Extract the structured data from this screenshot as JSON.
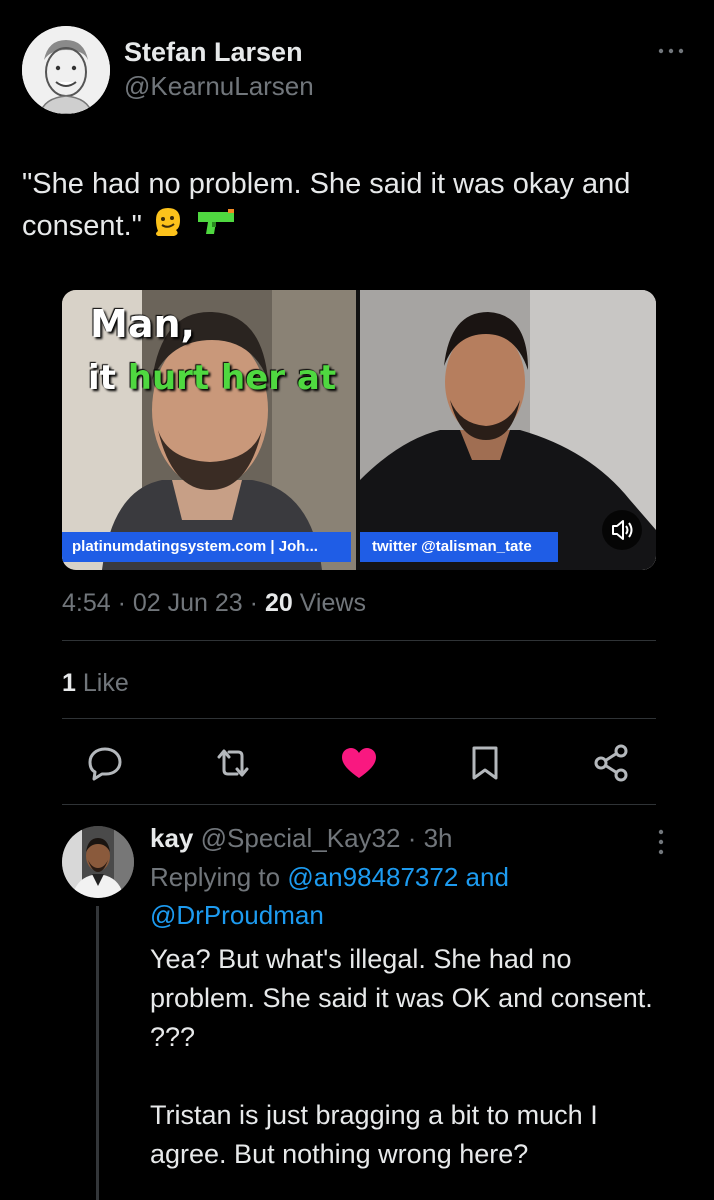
{
  "tweet": {
    "author_name": "Stefan Larsen",
    "author_handle": "@KearnuLarsen",
    "text": "\"She had no problem. She said it was okay and consent.\"",
    "emojis": [
      "melting-face-emoji",
      "water-pistol-emoji"
    ],
    "time": "4:54",
    "date": "02 Jun 23",
    "views_count": "20",
    "views_label": "Views",
    "likes_count": "1",
    "likes_label": "Like",
    "liked": true
  },
  "media": {
    "overlay_line1": "Man,",
    "overlay_line2_start": "it ",
    "overlay_line2_green": "hurt her at",
    "caption_left": "platinumdatingsystem.com | Joh...",
    "caption_right": "twitter @talisman_tate",
    "icons": [
      "speaker-icon"
    ]
  },
  "actions": {
    "icons": [
      "reply-icon",
      "retweet-icon",
      "like-icon",
      "bookmark-icon",
      "share-icon"
    ],
    "like_color": "#f91880"
  },
  "reply": {
    "name": "kay",
    "handle": "@Special_Kay32",
    "time": "3h",
    "replying_prefix": "Replying to",
    "mention1": "@an98487372",
    "connector": "and",
    "mention2": "@DrProudman",
    "text_para1": "Yea? But what's illegal. She had no problem. She said it was OK and consent. ???",
    "text_para2": "Tristan is just bragging a bit to much I agree. But nothing wrong here?"
  },
  "colors": {
    "background": "#000000",
    "text_primary": "#e7e9ea",
    "text_secondary": "#71767b",
    "link": "#1d9bf0",
    "caption_bar": "#1f5de6",
    "overlay_green": "#4fd840"
  }
}
